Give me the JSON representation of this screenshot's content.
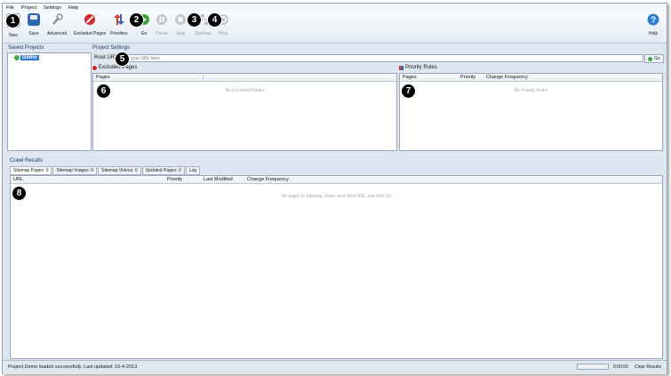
{
  "menu": [
    "File",
    "Project",
    "Settings",
    "Help"
  ],
  "toolbar": {
    "new": "New",
    "save": "Save",
    "advanced": "Advanced",
    "excluded": "Excluded Pages",
    "priorities": "Priorities",
    "go": "Go",
    "pause": "Pause",
    "stop": "Stop",
    "sitemap": "Sitemap",
    "ping": "Ping",
    "help": "Help"
  },
  "callouts": [
    "1",
    "2",
    "3",
    "4",
    "5",
    "6",
    "7",
    "8"
  ],
  "saved_projects": {
    "title": "Saved Projects",
    "item": "Demo"
  },
  "project_settings": {
    "title": "Project Settings",
    "root_url_label": "Root URL",
    "root_url_placeholder": "Type your URL here",
    "go_label": "Go"
  },
  "excluded_pages": {
    "title": "Excluded Pages",
    "col_pages": "Pages",
    "empty": "No Excluded Pages"
  },
  "priority_rules": {
    "title": "Priority Rules",
    "col_pages": "Pages",
    "col_priority": "Priority",
    "col_change": "Change Frequency",
    "empty": "No Priority Rules"
  },
  "crawl_results": {
    "title": "Crawl Results",
    "tabs": [
      "Sitemap Pages: 0",
      "Sitemap Images: 0",
      "Sitemap Videos: 0",
      "Updated Pages: 0",
      "Log"
    ],
    "col_url": "URL",
    "col_priority": "Priority",
    "col_modified": "Last Modified",
    "col_change": "Change Frequency",
    "empty": "No pages in Sitemap. Enter your Root URL and click Go"
  },
  "status": {
    "message": "Project Demo loaded successfully. Last updated: 16-4-2013",
    "time": "0:00:00",
    "clear": "Clear Results"
  },
  "colors": {
    "accent": "#1d3b66",
    "go_green": "#3aa53a",
    "excluded_red": "#d22a2a",
    "help_blue": "#2d7fd3"
  }
}
